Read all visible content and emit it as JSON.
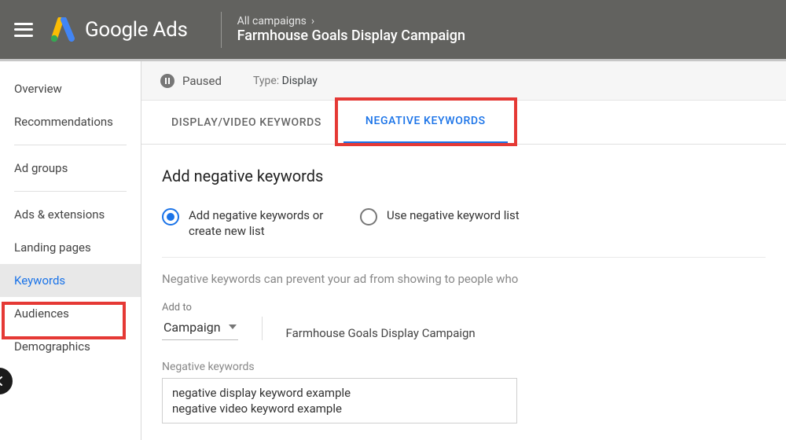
{
  "header": {
    "product_name": "Google Ads",
    "breadcrumb_top": "All campaigns",
    "breadcrumb_title": "Farmhouse Goals Display Campaign"
  },
  "sidebar": {
    "items": [
      {
        "label": "Overview"
      },
      {
        "label": "Recommendations"
      },
      {
        "label": "Ad groups"
      },
      {
        "label": "Ads & extensions"
      },
      {
        "label": "Landing pages"
      },
      {
        "label": "Keywords",
        "active": true
      },
      {
        "label": "Audiences"
      },
      {
        "label": "Demographics"
      }
    ]
  },
  "status": {
    "state": "Paused",
    "type_label": "Type:",
    "type_value": "Display"
  },
  "tabs": {
    "items": [
      {
        "label": "Display/Video Keywords"
      },
      {
        "label": "Negative Keywords",
        "active": true
      }
    ]
  },
  "content": {
    "section_title": "Add negative keywords",
    "radios": [
      {
        "label": "Add negative keywords or create new list",
        "selected": true
      },
      {
        "label": "Use negative keyword list",
        "selected": false
      }
    ],
    "description": "Negative keywords can prevent your ad from showing to people who",
    "addto_label": "Add to",
    "addto_select": "Campaign",
    "addto_value": "Farmhouse Goals Display Campaign",
    "negkw_label": "Negative keywords",
    "negkw_text": "negative display keyword example\nnegative video keyword example"
  }
}
